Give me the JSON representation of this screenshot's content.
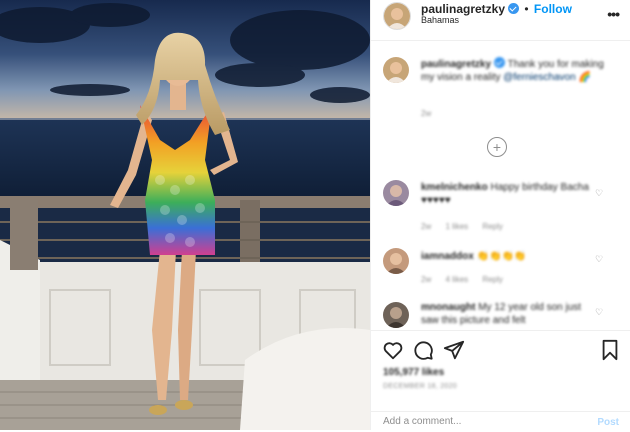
{
  "post": {
    "username": "paulinagretzky",
    "follow_separator": "•",
    "follow_label": "Follow",
    "location": "Bahamas",
    "more_icon": "more-horizontal-icon"
  },
  "caption": {
    "username": "paulinagretzky",
    "text": "Thank you for making my vision a reality",
    "mention": "@fernieschavon",
    "emoji": "🌈",
    "time": "2w"
  },
  "comments": [
    {
      "username": "kmelnichenko",
      "text": "Happy birthday Bacha ♥♥♥♥♥",
      "time": "2w",
      "likes": "1 likes",
      "reply": "Reply"
    },
    {
      "username": "iamnaddox",
      "text": "👏👏👏👏",
      "time": "2w",
      "likes": "4 likes",
      "reply": "Reply"
    },
    {
      "username": "mnonaught",
      "text": "My 12 year old son just saw this picture and felt",
      "time": "",
      "likes": "",
      "reply": ""
    }
  ],
  "actions": {
    "likes": "105,977 likes",
    "date": "DECEMBER 18, 2020"
  },
  "add_comment": {
    "placeholder": "Add a comment...",
    "post_label": "Post"
  },
  "colors": {
    "accent": "#0095f6",
    "muted": "#8e8e8e",
    "border": "#efefef"
  }
}
